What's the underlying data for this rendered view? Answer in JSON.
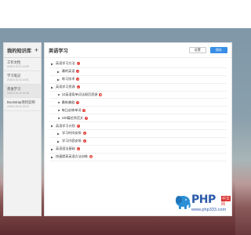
{
  "sidebar": {
    "title": "我的知识库",
    "add_label": "+",
    "items": [
      {
        "name": "工作文档",
        "date": "2018-9-30 11:14:59",
        "active": false
      },
      {
        "name": "学习笔记",
        "date": "2018-9-30 11:14:51",
        "active": false
      },
      {
        "name": "英语学习",
        "date": "2018-9-30 11:14:38",
        "active": true
      },
      {
        "name": "Bootstrap项目实例",
        "date": "2018-9-30 11:13:19",
        "active": false
      }
    ]
  },
  "main": {
    "title": "英语学习",
    "settings_label": "设置",
    "save_label": "保存",
    "tree": [
      {
        "label": "英语学习方法",
        "level": 1,
        "badge": true
      },
      {
        "label": "最的英语",
        "level": 2,
        "badge": true
      },
      {
        "label": "练习技术",
        "level": 2,
        "badge": true
      },
      {
        "label": "英语学习资源",
        "level": 1,
        "badge": true
      },
      {
        "label": "10英语背单词法网页资源",
        "level": 2,
        "badge": true
      },
      {
        "label": "最新美剧",
        "level": 2,
        "badge": true
      },
      {
        "label": "每日必练单词",
        "level": 2,
        "badge": true
      },
      {
        "label": "100篇优秀范文",
        "level": 2,
        "badge": true
      },
      {
        "label": "英语学习计划",
        "level": 1,
        "badge": true
      },
      {
        "label": "学习时间安排",
        "level": 2,
        "badge": true
      },
      {
        "label": "学习内容安排",
        "level": 2,
        "badge": true
      },
      {
        "label": "英语语法基础",
        "level": 1,
        "badge": true
      },
      {
        "label": "快速提高英语方法训练",
        "level": 1,
        "badge": true
      }
    ]
  },
  "watermark": {
    "brand": "PHP",
    "cn_top": "中文",
    "cn_bottom": "网",
    "url": "www.php333.com"
  },
  "colors": {
    "accent": "#3a8ee6",
    "badge": "#e2453c",
    "watermark_blue": "#2b5aa8"
  }
}
